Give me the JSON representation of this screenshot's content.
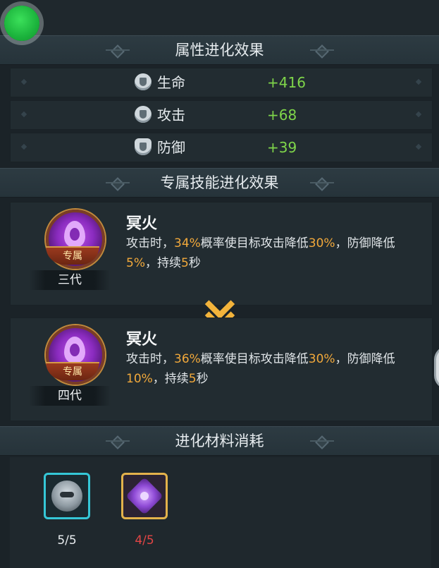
{
  "attribute_section": {
    "title": "属性进化效果",
    "rows": [
      {
        "icon": "heart-icon",
        "label": "生命",
        "value": "+416"
      },
      {
        "icon": "sword-icon",
        "label": "攻击",
        "value": "+68"
      },
      {
        "icon": "shield-icon",
        "label": "防御",
        "value": "+39"
      }
    ]
  },
  "skill_section": {
    "title": "专属技能进化效果",
    "current": {
      "generation": "三代",
      "badge": "专属",
      "name": "冥火",
      "desc": {
        "p1": "攻击时，",
        "v1": "34%",
        "p2": "概率使目标攻击降低",
        "v2": "30%",
        "p3": "，防御降低",
        "v3": "5%",
        "p4": "，持续",
        "v4": "5",
        "p5": "秒"
      }
    },
    "next": {
      "generation": "四代",
      "badge": "专属",
      "name": "冥火",
      "desc": {
        "p1": "攻击时，",
        "v1": "36%",
        "p2": "概率使目标攻击降低",
        "v2": "30%",
        "p3": "，防御降低",
        "v3": "10%",
        "p4": "，持续",
        "v4": "5",
        "p5": "秒"
      }
    }
  },
  "material_section": {
    "title": "进化材料消耗",
    "items": [
      {
        "icon": "hero-avatar-icon",
        "count": "5/5",
        "status_color": "#e8ecef"
      },
      {
        "icon": "purple-gem-icon",
        "count": "4/5",
        "status_color": "#e24545"
      }
    ]
  },
  "colors": {
    "increase": "#7fd64a",
    "highlight": "#f2a93b",
    "insufficient": "#e24545"
  }
}
